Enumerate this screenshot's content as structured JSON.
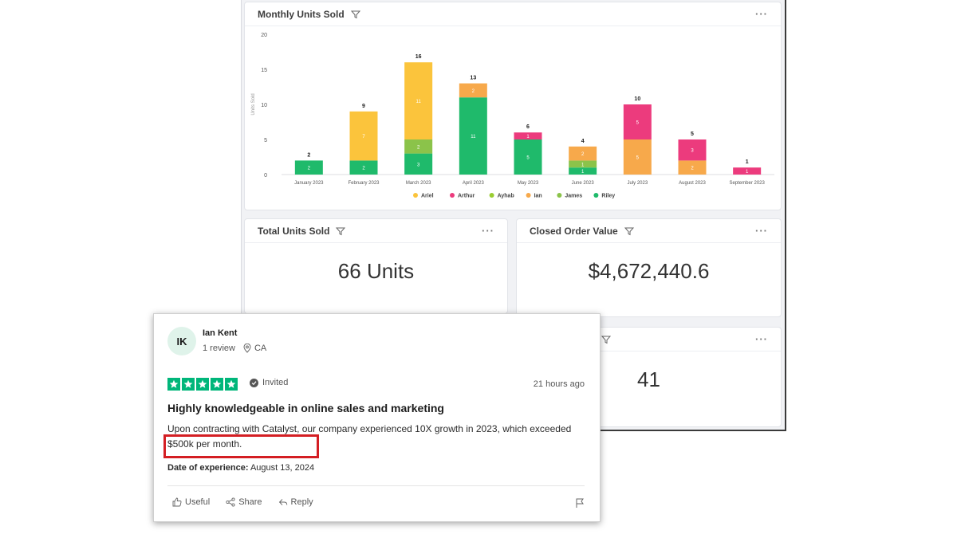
{
  "dashboard": {
    "chart_panel": {
      "title": "Monthly Units Sold",
      "menu": "···"
    },
    "units_panel": {
      "title": "Total Units Sold",
      "menu": "···",
      "value": "66 Units"
    },
    "value_panel": {
      "title": "Closed Order Value",
      "menu": "···",
      "value": "$4,672,440.6"
    },
    "fourth_panel": {
      "menu": "···",
      "value": "41"
    }
  },
  "chart_data": {
    "type": "bar",
    "stacked": true,
    "ylabel": "Units Sold",
    "ylim": [
      0,
      20
    ],
    "yticks": [
      0,
      5,
      10,
      15,
      20
    ],
    "categories": [
      "January 2023",
      "February 2023",
      "March 2023",
      "April 2023",
      "May 2023",
      "June 2023",
      "July 2023",
      "August 2023",
      "September 2023"
    ],
    "totals": [
      2,
      9,
      16,
      13,
      6,
      4,
      10,
      5,
      1
    ],
    "series": [
      {
        "name": "Riley",
        "color": "#1fba6b",
        "values": [
          2,
          2,
          3,
          11,
          5,
          1,
          0,
          0,
          0
        ]
      },
      {
        "name": "James",
        "color": "#8bc34a",
        "values": [
          0,
          0,
          2,
          0,
          0,
          1,
          0,
          0,
          0
        ]
      },
      {
        "name": "Ian",
        "color": "#f7a94b",
        "values": [
          0,
          0,
          0,
          2,
          0,
          2,
          5,
          2,
          0
        ]
      },
      {
        "name": "Ayhab",
        "color": "#9acd32",
        "values": [
          0,
          0,
          0,
          0,
          0,
          0,
          0,
          0,
          0
        ]
      },
      {
        "name": "Arthur",
        "color": "#ec3b7d",
        "values": [
          0,
          0,
          0,
          0,
          1,
          0,
          5,
          3,
          1
        ]
      },
      {
        "name": "Ariel",
        "color": "#fbc43c",
        "values": [
          0,
          7,
          11,
          0,
          0,
          0,
          0,
          0,
          0
        ]
      }
    ],
    "legend_order": [
      "Ariel",
      "Arthur",
      "Ayhab",
      "Ian",
      "James",
      "Riley"
    ],
    "legend_position": "bottom",
    "grid": false
  },
  "review": {
    "initials": "IK",
    "name": "Ian Kent",
    "review_count": "1 review",
    "location": "CA",
    "rating": 5,
    "invited": "Invited",
    "time": "21 hours ago",
    "title": "Highly knowledgeable in online sales and marketing",
    "body": "Upon contracting with Catalyst, our company experienced 10X growth in 2023, which exceeded $500k per month.",
    "date_label": "Date of experience:",
    "date_value": "August 13, 2024",
    "actions": {
      "useful": "Useful",
      "share": "Share",
      "reply": "Reply"
    }
  }
}
